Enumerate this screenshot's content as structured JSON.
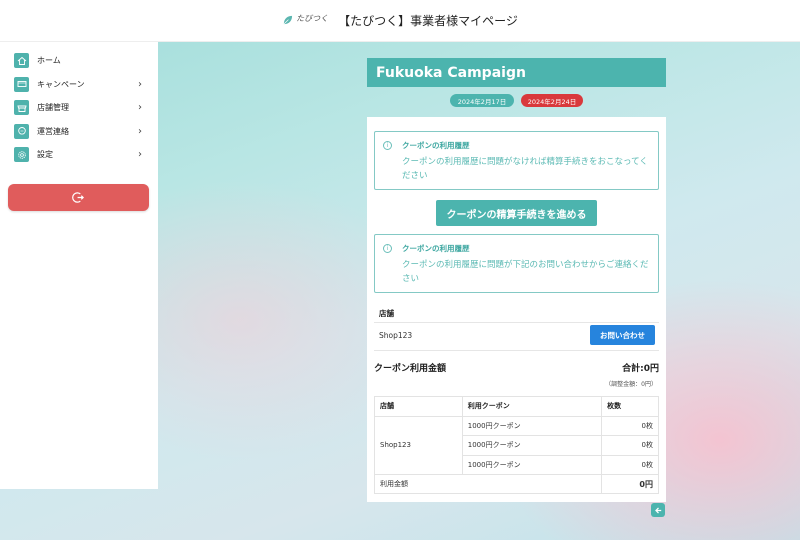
{
  "header": {
    "logo_text": "たびつく",
    "title": "【たびつく】事業者様マイページ"
  },
  "sidebar": {
    "items": [
      {
        "label": "ホーム",
        "icon": "home-icon"
      },
      {
        "label": "キャンペーン",
        "icon": "ticket-icon"
      },
      {
        "label": "店舗管理",
        "icon": "store-icon"
      },
      {
        "label": "運営連絡",
        "icon": "chat-icon"
      },
      {
        "label": "設定",
        "icon": "gear-icon"
      }
    ],
    "logout_icon": "logout-icon"
  },
  "campaign": {
    "title": "Fukuoka Campaign",
    "start_date": "2024年2月17日",
    "end_date": "2024年2月24日"
  },
  "notices": [
    {
      "heading": "クーポンの利用履歴",
      "text": "クーポンの利用履歴に問題がなければ精算手続きをおこなってください"
    },
    {
      "heading": "クーポンの利用履歴",
      "text": "クーポンの利用履歴に問題が下記のお問い合わせからご連絡ください"
    }
  ],
  "settle_button": "クーポンの精算手続きを進める",
  "store": {
    "label": "店舗",
    "name": "Shop123",
    "contact_button": "お問い合わせ"
  },
  "amount": {
    "heading": "クーポン利用金額",
    "total": "合計:0円",
    "adjust": "（調整金額：0円）"
  },
  "usage_table": {
    "headers": [
      "店舗",
      "利用クーポン",
      "枚数"
    ],
    "store": "Shop123",
    "rows": [
      {
        "coupon": "1000円クーポン",
        "qty": "0枚"
      },
      {
        "coupon": "1000円クーポン",
        "qty": "0枚"
      },
      {
        "coupon": "1000円クーポン",
        "qty": "0枚"
      }
    ],
    "sum_label": "利用金額",
    "sum_value": "0円"
  },
  "colors": {
    "primary": "#4cb4ae",
    "danger": "#d9393c",
    "logout": "#e05c5c",
    "contact": "#2684dd"
  }
}
